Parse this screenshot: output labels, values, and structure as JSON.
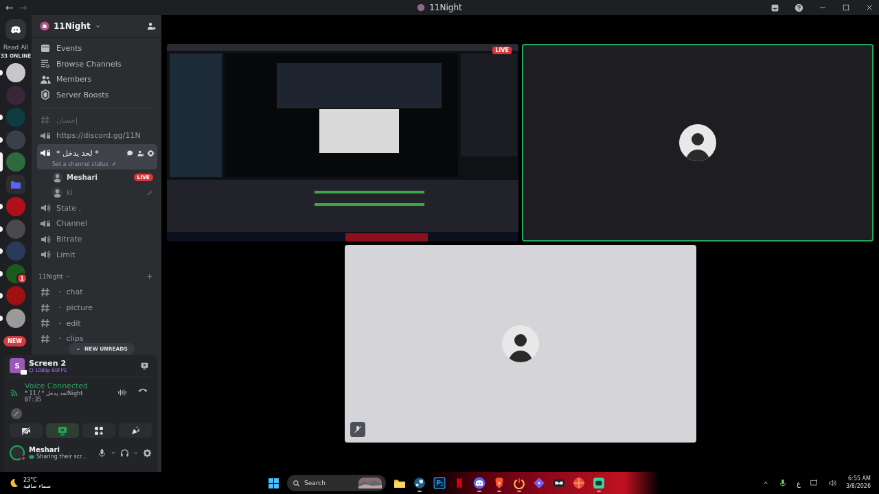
{
  "titlebar": {
    "back": "←",
    "forward": "→",
    "title": "11Night"
  },
  "rail": {
    "read_all": "Read All",
    "online": "33 ONLINE",
    "new_badge": "NEW"
  },
  "servers": [
    {
      "color": "#c8c8c8",
      "unread": true,
      "selected": false
    },
    {
      "color": "#3b2638",
      "unread": false,
      "selected": false
    },
    {
      "color": "#0d3b40",
      "unread": true,
      "selected": false
    },
    {
      "color": "#3a4048",
      "unread": true,
      "selected": false
    },
    {
      "color": "#2f6a3c",
      "unread": false,
      "selected": true
    },
    {
      "color": "#5865f2",
      "kind": "folder",
      "unread": false,
      "selected": false
    },
    {
      "color": "#b0101c",
      "unread": true,
      "selected": false
    },
    {
      "color": "#4a4a4a",
      "unread": true,
      "selected": false
    },
    {
      "color": "#2a3a5a",
      "unread": true,
      "selected": false
    },
    {
      "color": "#1a5a1a",
      "unread": true,
      "selected": false,
      "badge": "1"
    },
    {
      "color": "#a01010",
      "unread": true,
      "selected": false
    },
    {
      "color": "#9a9a9a",
      "unread": true,
      "selected": false
    }
  ],
  "server_header": {
    "name": "11Night"
  },
  "menu": [
    {
      "kind": "events",
      "label": "Events"
    },
    {
      "kind": "browse",
      "label": "Browse Channels"
    },
    {
      "kind": "members",
      "label": "Members"
    },
    {
      "kind": "boosts",
      "label": "Server Boosts"
    }
  ],
  "channels": [
    {
      "kind": "text",
      "name": "إحسان",
      "muted": true,
      "selected": false
    },
    {
      "kind": "voice-locked",
      "name": "https://discord.gg/11N",
      "muted": false,
      "selected": false
    },
    {
      "kind": "voice-locked",
      "name": "* لحد يدخل *",
      "muted": false,
      "selected": true,
      "status": "Set a channel status",
      "members": [
        {
          "name": "Meshari",
          "live": "LIVE",
          "muted": false
        },
        {
          "name": "kl",
          "muted": true
        }
      ]
    },
    {
      "kind": "voice",
      "name": "State .",
      "muted": false,
      "selected": false
    },
    {
      "kind": "voice-locked",
      "name": "Channel",
      "muted": false,
      "selected": false
    },
    {
      "kind": "voice",
      "name": "Bitrate",
      "muted": false,
      "selected": false
    },
    {
      "kind": "voice",
      "name": "Limit",
      "muted": false,
      "selected": false
    }
  ],
  "category": {
    "name": "11Night",
    "channels": [
      {
        "kind": "text",
        "name": "・ chat",
        "muted": false,
        "selected": false
      },
      {
        "kind": "text",
        "name": "・ picture",
        "muted": false,
        "selected": false
      },
      {
        "kind": "text",
        "name": "・ edit",
        "muted": false,
        "selected": false
      },
      {
        "kind": "text",
        "name": "・ clips",
        "muted": false,
        "selected": false
      }
    ]
  },
  "new_unreads": "NEW UNREADS",
  "stream": {
    "avatar_letter": "S",
    "title": "Screen 2",
    "quality": "1080p 60FPS"
  },
  "voice": {
    "status": "Voice Connected",
    "channel": "* 11 / * لحد يدخلNight",
    "time": "07:35"
  },
  "voice_buttons": [
    {
      "kind": "camera",
      "on": false
    },
    {
      "kind": "screen",
      "on": true
    },
    {
      "kind": "activities",
      "on": false
    },
    {
      "kind": "soundboard",
      "on": false
    }
  ],
  "user": {
    "name": "Meshari",
    "activity": "Sharing their scr..."
  },
  "tiles": [
    {
      "kind": "screen",
      "live": "LIVE",
      "speaking": false
    },
    {
      "kind": "camera",
      "speaking": true,
      "muted": false
    },
    {
      "kind": "camera",
      "speaking": false,
      "muted": true
    }
  ],
  "taskbar": {
    "temperature": "23°C",
    "weather": "سماء صافية",
    "search_placeholder": "Search",
    "apps": [
      {
        "kind": "folder",
        "running": false
      },
      {
        "kind": "steam",
        "running": true
      },
      {
        "kind": "ps",
        "running": false
      },
      {
        "kind": "netflix",
        "running": false
      },
      {
        "kind": "discord",
        "running": true
      },
      {
        "kind": "brave",
        "running": true
      },
      {
        "kind": "power",
        "running": true
      },
      {
        "kind": "diamond",
        "running": false
      },
      {
        "kind": "mask",
        "running": false
      },
      {
        "kind": "ball",
        "running": false
      },
      {
        "kind": "chat",
        "running": true
      }
    ],
    "language": "ع",
    "time": "6:55 AM",
    "date": "3/8/2026"
  }
}
